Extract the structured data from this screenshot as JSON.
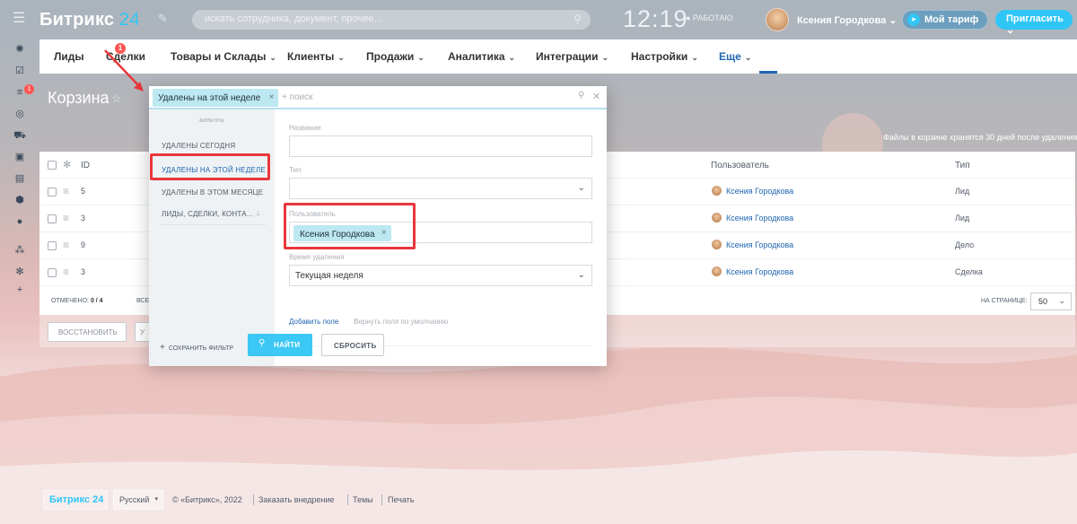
{
  "header": {
    "logo_main": "Битрикс",
    "logo_num": "24",
    "search_placeholder": "искать сотрудника, документ, прочее...",
    "clock": "12:19",
    "status": "● РАБОТАЮ",
    "user_name": "Ксения Городкова ⌄",
    "tariff_label": "Мой тариф",
    "invite_label": "Пригласить ⌄"
  },
  "rail": {
    "badge": "1"
  },
  "nav": {
    "badge": "1",
    "items": [
      "Лиды",
      "Сделки",
      "Товары и Склады",
      "Клиенты",
      "Продажи",
      "Аналитика",
      "Интеграции",
      "Настройки",
      "Еще"
    ]
  },
  "page": {
    "title": "Корзина",
    "notice": "Файлы в корзине хранятся 30 дней после удаления"
  },
  "grid": {
    "columns": {
      "id": "ID",
      "user": "Пользователь",
      "type": "Тип"
    },
    "rows": [
      {
        "id": "5",
        "user": "Ксения Городкова",
        "type": "Лид"
      },
      {
        "id": "3",
        "user": "Ксения Городкова",
        "type": "Лид"
      },
      {
        "id": "9",
        "user": "Ксения Городкова",
        "type": "Дело"
      },
      {
        "id": "3",
        "user": "Ксения Городкова",
        "type": "Сделка"
      }
    ],
    "selected_label": "ОТМЕЧЕНО:",
    "selected_value": "0 / 4",
    "total_label": "ВСЕ",
    "per_page_label": "НА СТРАНИЦЕ:",
    "per_page_value": "50"
  },
  "actions": {
    "restore": "ВОССТАНОВИТЬ",
    "delete": "У"
  },
  "filter": {
    "active_tag": "Удалены на этой неделе",
    "add_placeholder": "+ поиск",
    "presets_header": "ФИЛЬТРЫ",
    "presets": [
      "УДАЛЕНЫ СЕГОДНЯ",
      "УДАЛЕНЫ НА ЭТОЙ НЕДЕЛЕ",
      "УДАЛЕНЫ В ЭТОМ МЕСЯЦЕ",
      "ЛИДЫ, СДЕЛКИ, КОНТА..."
    ],
    "save_filter": "СОХРАНИТЬ ФИЛЬТР",
    "fields": {
      "name_label": "Название",
      "type_label": "Тип",
      "user_label": "Пользователь",
      "user_value": "Ксения Городкова",
      "time_label": "Время удаления",
      "time_value": "Текущая неделя"
    },
    "add_field": "Добавить поле",
    "reset_fields": "Вернуть поля по умолчанию",
    "find": "НАЙТИ",
    "reset": "СБРОСИТЬ"
  },
  "footer": {
    "logo": "Битрикс 24",
    "lang": "Русский",
    "copyright": "© «Битрикс», 2022",
    "order": "Заказать внедрение",
    "themes": "Темы",
    "print": "Печать"
  },
  "colors": {
    "accent": "#2fc6f6",
    "link": "#2067b0",
    "highlight": "#e8373c",
    "badge": "#ff5752"
  }
}
